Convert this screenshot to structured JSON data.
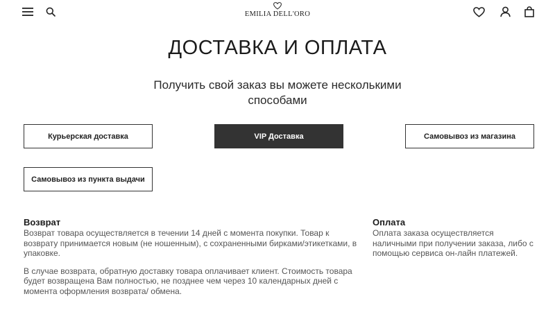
{
  "header": {
    "brand": "EMILIA DELL'ORO",
    "icons": [
      "menu-icon",
      "search-icon",
      "heart-icon",
      "user-icon",
      "bag-icon"
    ]
  },
  "main": {
    "title": "ДОСТАВКА И ОПЛАТА",
    "subtitle": "Получить свой заказ вы можете несколькими способами",
    "delivery_options": [
      {
        "label": "Курьерская доставка",
        "active": false
      },
      {
        "label": "VIP Доставка",
        "active": true
      },
      {
        "label": "Самовывоз из магазина",
        "active": false
      },
      {
        "label": "Самовывоз из пункта выдачи",
        "active": false
      }
    ]
  },
  "return_section": {
    "title": "Возврат",
    "paragraph1": "Возврат товара осуществляется в течении 14 дней с момента покупки. Товар к возврату принимается новым (не ношенным), с сохраненными бирками/этикетками, в упаковке.",
    "paragraph2": "В случае возврата, обратную доставку товара оплачивает клиент. Стоимость товара будет возвращена Вам полностью, не позднее чем через 10 календарных дней с момента оформления возврата/ обмена."
  },
  "payment_section": {
    "title": "Оплата",
    "paragraph1": "Оплата заказа осуществляется наличными при получении заказа, либо с помощью сервиса он-лайн платежей."
  },
  "colors": {
    "active_button_bg": "#333333",
    "text_dark": "#1b1b1b",
    "text_muted": "#555555"
  }
}
